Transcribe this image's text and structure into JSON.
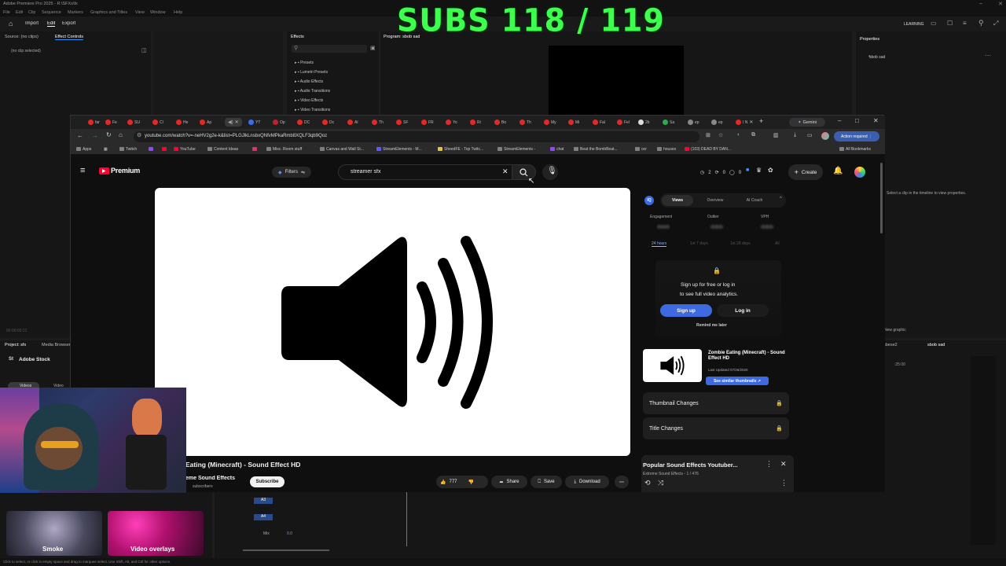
{
  "premiere": {
    "title": "Adobe Premiere Pro 2025 - R:\\SFXs\\fx",
    "menu": [
      "File",
      "Edit",
      "Clip",
      "Sequence",
      "Markers",
      "Graphics and Titles",
      "View",
      "Window",
      "Help"
    ],
    "top_tabs": [
      "Import",
      "Edit",
      "Export"
    ],
    "workspace": "LEARNING",
    "source_tab": "Source: (no clips)",
    "effect_controls_tab": "Effect Controls",
    "no_clip": "(no clip selected)",
    "effects_tab": "Effects",
    "effects_items": [
      "Presets",
      "Lumetri Presets",
      "Audio Effects",
      "Audio Transitions",
      "Video Effects",
      "Video Transitions"
    ],
    "program_tab": "Program: sbob sad",
    "properties_tab": "Properties",
    "properties_clip": "sbob sad",
    "properties_hint": "Select a clip in the timeline to view properties.",
    "timecode": "00:00:03:21",
    "project_tab": "Project: sfx",
    "media_browser_tab": "Media Browser",
    "adobe_stock": "Adobe Stock",
    "stock_filters": [
      "Videos",
      "Video"
    ],
    "stock_items": [
      "Smoke",
      "Video overlays"
    ],
    "new_graphic": "New graphic",
    "sequence_tabs": [
      "sbese2",
      "sbob sad"
    ],
    "sequence_timecode": ":25:00",
    "tracks": [
      "A3",
      "A4",
      "Mix"
    ],
    "mix_value": "0.0",
    "status_bar": "Click to select, or click in empty space and drag to marquee select. Use Shift, Alt, and Ctrl for other options."
  },
  "overlay": {
    "subs": "SUBS 118 / 119"
  },
  "browser": {
    "tabs": [
      "far",
      "Fe",
      "SU",
      "Cl",
      "He",
      "Ap",
      "",
      "YT",
      "Op",
      "DC",
      "Dc",
      "Al",
      "Th",
      "SF",
      "FR",
      "Yo",
      "Ri",
      "Bo",
      "Th",
      "My",
      "Mi",
      "Fal",
      "Fel",
      "2b",
      "Sa",
      "ep",
      "ep",
      "I N"
    ],
    "gemini": "Gemini",
    "url": "youtube.com/watch?v=-neHV2g2e-k&list=PLGJlkLnsbxQNfvMPkaRmb8XQLF3qb9Qoz",
    "action_required": "Action required",
    "bookmarks": [
      "Apps",
      "Twitch",
      "",
      "YouTube",
      "Content Ideas",
      "",
      "Misc. Room stuff",
      "Canvas and Wall St...",
      "StreamElements - M...",
      "SheedFE - Top Twitc...",
      "StreamElements -",
      "chat",
      "Beat the BombBeat...",
      "ocr",
      "houses",
      "(103) DEAD BY DAN..."
    ],
    "all_bookmarks": "All Bookmarks"
  },
  "youtube": {
    "logo": "Premium",
    "filters": "Filters",
    "search_value": "streamer sfx",
    "stats": [
      "2",
      "0",
      "0"
    ],
    "create": "Create",
    "video_title": "Eating (Minecraft) - Sound Effect HD",
    "channel": "eme Sound Effects",
    "subscribers": "subscribers",
    "subscribe": "Subscribe",
    "likes": "777",
    "share": "Share",
    "save": "Save",
    "download": "Download",
    "ext": {
      "badge": "IQ",
      "tabs": [
        "Views",
        "Overview",
        "AI Coach"
      ],
      "metrics": [
        "Engagement",
        "Outlier",
        "VPH"
      ],
      "ranges": [
        "24 hours",
        "1st 7 days",
        "1st 28 days",
        "All"
      ],
      "signup_line1": "Sign up for",
      "signup_free": "free",
      "signup_line1b": "or log in",
      "signup_line2": "to see full video analytics.",
      "sign_up": "Sign up",
      "log_in": "Log in",
      "remind": "Remind me later",
      "thumb_title": "Zombie Eating (Minecraft) - Sound Effect HD",
      "updated": "Last Updated 07/26/2020",
      "similar": "See similar thumbnails",
      "thumbnail_changes": "Thumbnail Changes",
      "title_changes": "Title Changes"
    },
    "playlist_title": "Popular Sound Effects Youtuber...",
    "playlist_sub": "Extreme Sound Effects - 1 / 476"
  },
  "colors": {
    "subs_green": "#3cff4e",
    "yt_red": "#ff0033",
    "blue_button": "#3e6ae1"
  }
}
